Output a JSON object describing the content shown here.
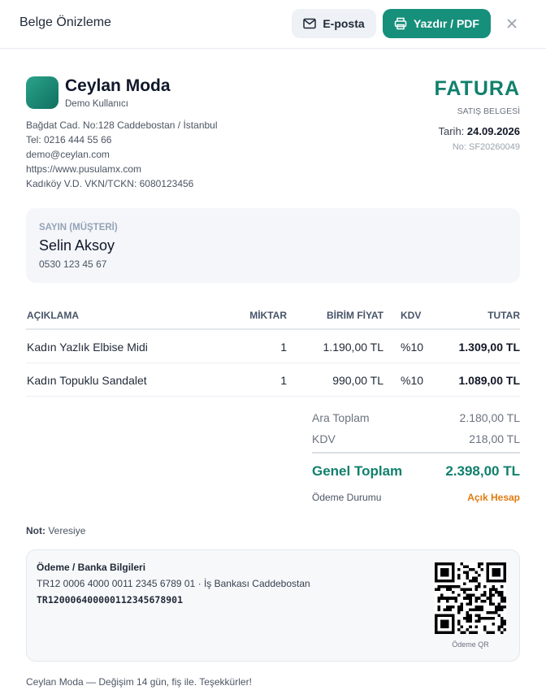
{
  "header": {
    "title": "Belge Önizleme",
    "email_label": "E-posta",
    "print_label": "Yazdır / PDF",
    "close_glyph": "×"
  },
  "company": {
    "name": "Ceylan Moda",
    "user": "Demo Kullanıcı",
    "address": "Bağdat Cad. No:128 Caddebostan / İstanbul",
    "phone": "Tel: 0216 444 55 66",
    "email": "demo@ceylan.com",
    "website": "https://www.pusulamx.com",
    "tax": "Kadıköy V.D. VKN/TCKN: 6080123456"
  },
  "invoice": {
    "title": "FATURA",
    "subtitle": "SATIŞ BELGESİ",
    "date_label": "Tarih:",
    "date": "24.09.2026",
    "number": "No: SF20260049"
  },
  "customer": {
    "label": "SAYIN (MÜŞTERİ)",
    "name": "Selin Aksoy",
    "phone": "0530 123 45 67"
  },
  "table": {
    "headers": {
      "description": "AÇIKLAMA",
      "quantity": "MİKTAR",
      "unit_price": "BİRİM FİYAT",
      "vat": "KDV",
      "total": "TUTAR"
    },
    "rows": [
      {
        "description": "Kadın Yazlık Elbise Midi",
        "quantity": "1",
        "unit_price": "1.190,00 TL",
        "vat": "%10",
        "total": "1.309,00 TL"
      },
      {
        "description": "Kadın Topuklu Sandalet",
        "quantity": "1",
        "unit_price": "990,00 TL",
        "vat": "%10",
        "total": "1.089,00 TL"
      }
    ]
  },
  "totals": {
    "subtotal_label": "Ara Toplam",
    "subtotal": "2.180,00 TL",
    "vat_label": "KDV",
    "vat": "218,00 TL",
    "grand_label": "Genel Toplam",
    "grand": "2.398,00 TL",
    "payment_label": "Ödeme Durumu",
    "payment_status": "Açık Hesap"
  },
  "note": {
    "label": "Not:",
    "text": "Veresiye"
  },
  "bank": {
    "title": "Ödeme / Banka Bilgileri",
    "line": "TR12 0006 4000 0011 2345 6789 01 · İş Bankası Caddebostan",
    "iban": "TR120006400000112345678901",
    "qr_label": "Ödeme QR"
  },
  "footer": {
    "text": "Ceylan Moda — Değişim 14 gün, fiş ile. Teşekkürler!"
  },
  "colors": {
    "accent": "#11806d",
    "button": "#168f7b",
    "status": "#e07b0f"
  }
}
